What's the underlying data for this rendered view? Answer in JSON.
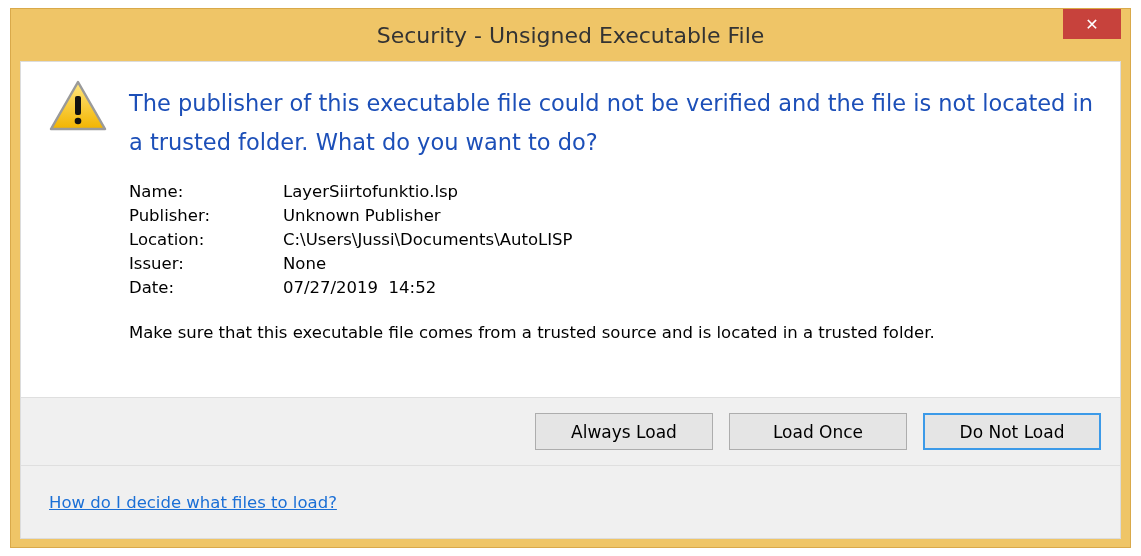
{
  "window": {
    "title": "Security - Unsigned Executable File",
    "close": "✕"
  },
  "message": {
    "heading": "The publisher of this executable file could not be verified and the file is not located in a trusted folder. What do you want to do?"
  },
  "details": [
    {
      "label": "Name:",
      "value": "LayerSiirtofunktio.lsp"
    },
    {
      "label": "Publisher:",
      "value": "Unknown Publisher"
    },
    {
      "label": "Location:",
      "value": "C:\\Users\\Jussi\\Documents\\AutoLISP"
    },
    {
      "label": "Issuer:",
      "value": "None"
    },
    {
      "label": "Date:",
      "value": "07/27/2019  14:52"
    }
  ],
  "note": "Make sure that this executable file comes from a trusted source and is located in a trusted folder.",
  "buttons": [
    {
      "label": "Always Load",
      "default": false
    },
    {
      "label": "Load Once",
      "default": false
    },
    {
      "label": "Do Not Load",
      "default": true
    }
  ],
  "help_link": "How do I decide what files to load?"
}
